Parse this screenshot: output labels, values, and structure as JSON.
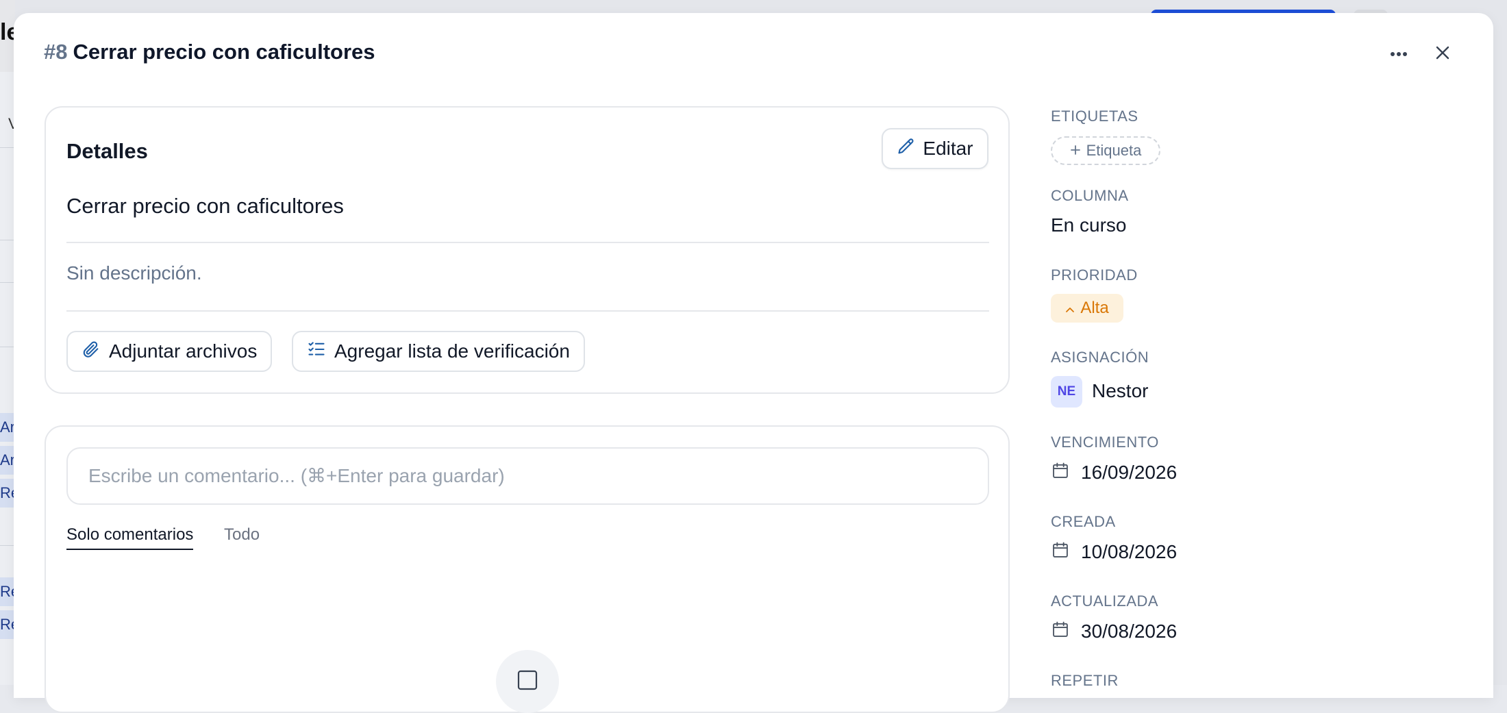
{
  "background": {
    "title_fragment": "le",
    "v_fragment": "V",
    "chips": [
      "Ar",
      "Ar",
      "Re",
      "Re",
      "Re"
    ]
  },
  "modal": {
    "task_number": "#8",
    "task_title": "Cerrar precio con caficultores",
    "more_icon": "more-horizontal-icon",
    "close_icon": "close-icon"
  },
  "details": {
    "heading": "Detalles",
    "edit_label": "Editar",
    "task_name": "Cerrar precio con caficultores",
    "description": "Sin descripción.",
    "attach_label": "Adjuntar archivos",
    "checklist_label": "Agregar lista de verificación"
  },
  "comments": {
    "placeholder": "Escribe un comentario... (⌘+Enter para guardar)",
    "tabs": [
      {
        "label": "Solo comentarios",
        "active": true
      },
      {
        "label": "Todo",
        "active": false
      }
    ]
  },
  "sidebar": {
    "tags_label": "ETIQUETAS",
    "add_tag_label": "Etiqueta",
    "column_label": "COLUMNA",
    "column_value": "En curso",
    "priority_label": "PRIORIDAD",
    "priority_value": "Alta",
    "assignment_label": "ASIGNACIÓN",
    "assignee_initials": "NE",
    "assignee_name": "Nestor",
    "due_label": "VENCIMIENTO",
    "due_value": "16/09/2026",
    "created_label": "CREADA",
    "created_value": "10/08/2026",
    "updated_label": "ACTUALIZADA",
    "updated_value": "30/08/2026",
    "repeat_label": "REPETIR"
  },
  "colors": {
    "accent": "#1d4ed8",
    "priority_high_bg": "#fdf1dc",
    "priority_high_text": "#d97706",
    "avatar_bg": "#e0e7ff",
    "avatar_text": "#4f46e5"
  }
}
